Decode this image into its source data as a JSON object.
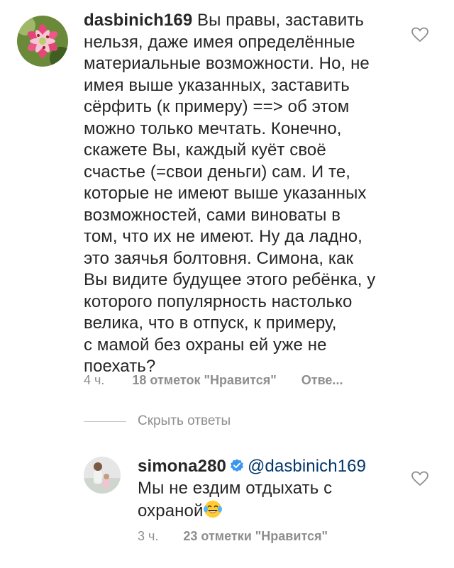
{
  "comments": [
    {
      "username": "dasbinich169",
      "lines": [
        " Вы правы, заставить",
        "нельзя, даже имея определённые",
        "материальные возможности. Но, не",
        "имея выше указанных, заставить",
        "сёрфить (к примеру) ==> об этом",
        "можно только мечтать. Конечно,",
        "скажете Вы, каждый куёт своё",
        "счастье (=свои деньги) сам. И те,",
        "которые не имеют выше указанных",
        "возможностей, сами виноваты в",
        "том, что их не имеют. Ну да ладно,",
        "это заячья болтовня. Симона, как",
        "Вы видите будущее этого ребёнка, у",
        "которого популярность настолько",
        "велика, что в отпуск, к примеру,",
        "с мамой без охраны ей уже не",
        "поехать?"
      ],
      "time": "4 ч.",
      "likes": "18 отметок \"Нравится\"",
      "reply": "Отве..."
    }
  ],
  "hide_replies_label": "Скрыть ответы",
  "reply": {
    "username": "simona280",
    "mention": "@dasbinich169",
    "line1": "Мы не ездим отдыхать с",
    "line2": "охраной",
    "emoji": "laughing-tears-emoji",
    "time": "3 ч.",
    "likes": "23 отметки \"Нравится\""
  },
  "colors": {
    "text": "#262626",
    "muted": "#8e8e8e",
    "mention": "#00376b",
    "verified": "#3897f0"
  }
}
